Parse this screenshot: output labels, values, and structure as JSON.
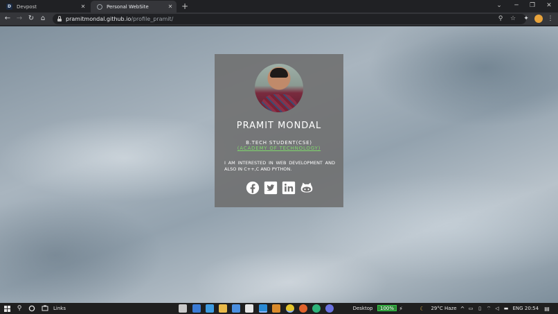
{
  "browser": {
    "tabs": [
      {
        "title": "Devpost",
        "favicon": "D",
        "active": false
      },
      {
        "title": "Personal WebSite",
        "active": true
      }
    ],
    "url_domain": "pramitmondal.github.io",
    "url_path": "/profile_pramit/"
  },
  "profile": {
    "name": "PRAMIT MONDAL",
    "degree": "B.TECH STUDENT(CSE)",
    "college": "(ACADEMY OF TECHNOLOGY)",
    "bio": "I AM INTERESTED IN WEB DEVELOPMENT AND ALSO IN C++,C AND PYTHON.",
    "socials": [
      "facebook-icon",
      "twitter-icon",
      "linkedin-icon",
      "github-icon"
    ],
    "link_color": "#7fd86b"
  },
  "taskbar": {
    "links_label": "Links",
    "desktop_label": "Desktop",
    "battery": "100%",
    "weather": "29°C  Haze",
    "language": "ENG",
    "time": "20:54"
  }
}
